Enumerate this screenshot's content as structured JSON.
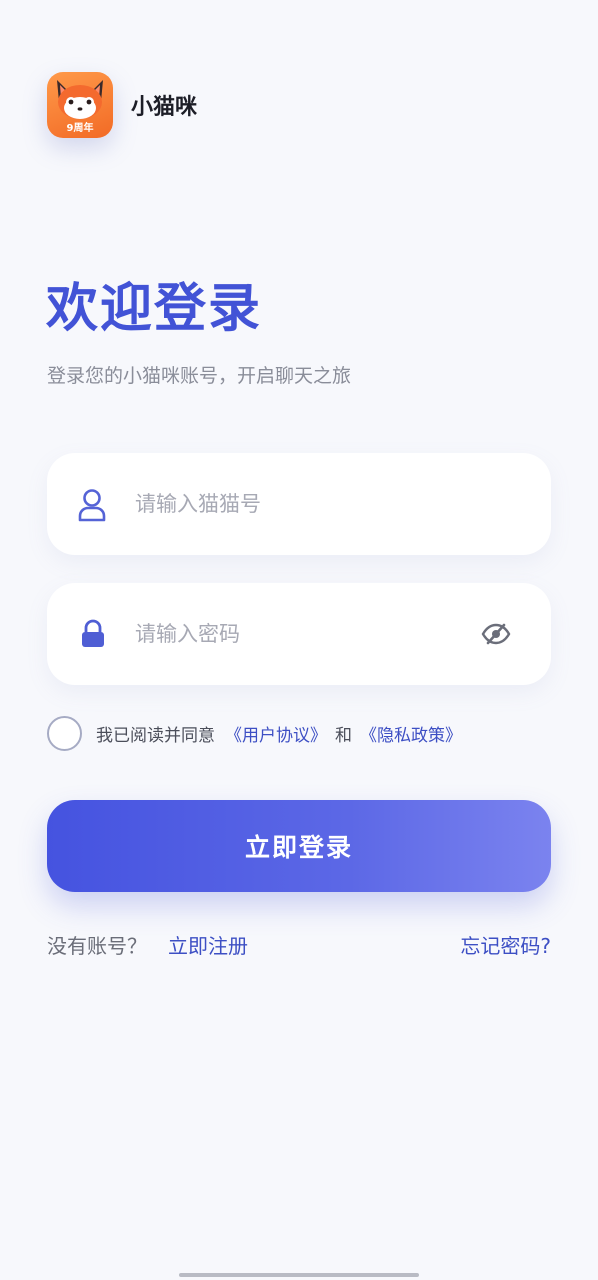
{
  "app": {
    "name": "小猫咪",
    "logo_badge": "9周年",
    "logo_icon": "fox-mascot-icon"
  },
  "welcome": {
    "title": "欢迎登录",
    "subtitle": "登录您的小猫咪账号，开启聊天之旅"
  },
  "form": {
    "account": {
      "placeholder": "请输入猫猫号",
      "value": "",
      "icon": "user-icon"
    },
    "password": {
      "placeholder": "请输入密码",
      "value": "",
      "icon": "lock-icon",
      "toggle_icon": "eye-hidden-icon"
    }
  },
  "agreement": {
    "checked": false,
    "prefix": "我已阅读并同意",
    "user_agreement": "《用户协议》",
    "and": "和",
    "privacy_policy": "《隐私政策》"
  },
  "login_button": "立即登录",
  "footer": {
    "no_account": "没有账号？",
    "register": "立即注册",
    "forgot_password": "忘记密码?"
  },
  "colors": {
    "accent": "#4253d6",
    "link": "#3d4fc4",
    "background": "#f7f8fc"
  }
}
